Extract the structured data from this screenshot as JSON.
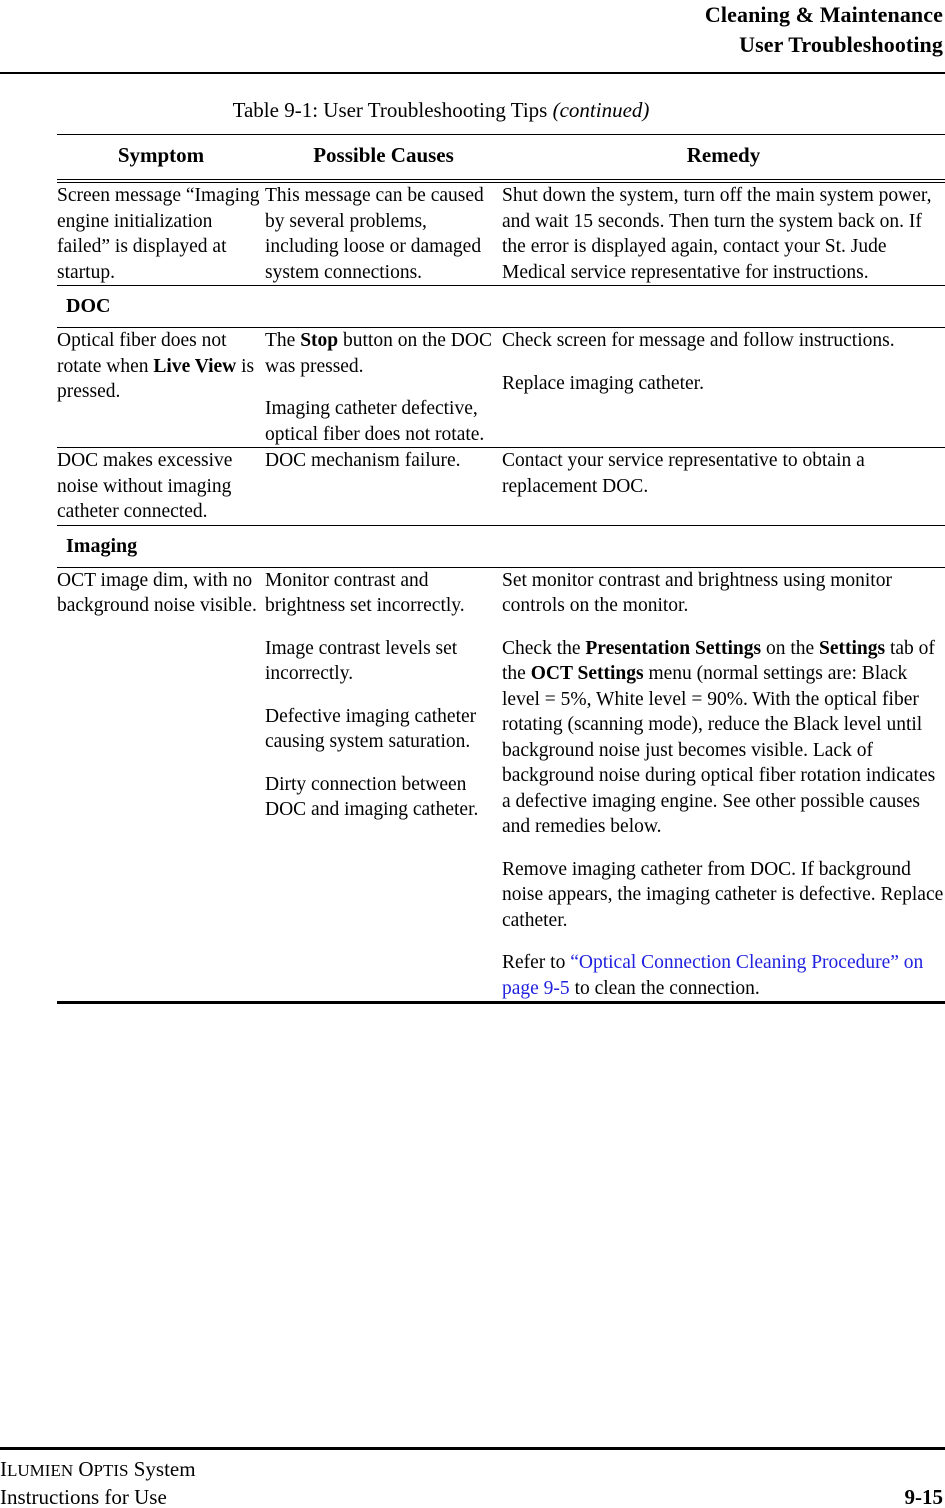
{
  "header": {
    "line1": "Cleaning & Maintenance",
    "line2": "User Troubleshooting"
  },
  "table": {
    "caption_main": "Table 9-1:  User Troubleshooting Tips ",
    "caption_continued": "(continued)",
    "columns": [
      "Symptom",
      "Possible Causes",
      "Remedy"
    ],
    "rows": [
      {
        "type": "data",
        "symptom": "Screen message “Imaging engine initialization failed” is displayed at startup.",
        "causes": [
          "This message can be caused by several problems, including loose or damaged system connections."
        ],
        "remedies": [
          "Shut down the system, turn off the main system power, and wait 15 seconds. Then turn the system back on. If the error is displayed again, contact your St. Jude Medical service representative for instructions."
        ]
      },
      {
        "type": "section",
        "label": "DOC"
      },
      {
        "type": "data",
        "symptom_parts": [
          {
            "text": "Optical fiber does not rotate when ",
            "bold": false
          },
          {
            "text": "Live View",
            "bold": true
          },
          {
            "text": " is pressed.",
            "bold": false
          }
        ],
        "causes_parts": [
          [
            {
              "text": "The ",
              "bold": false
            },
            {
              "text": "Stop",
              "bold": true
            },
            {
              "text": " button on the DOC was pressed.",
              "bold": false
            }
          ],
          [
            {
              "text": "Imaging catheter defective, optical fiber does not rotate.",
              "bold": false
            }
          ]
        ],
        "remedies_parts": [
          [
            {
              "text": "Check screen for message and follow instructions.",
              "bold": false
            }
          ],
          [
            {
              "text": "Replace imaging catheter.",
              "bold": false
            }
          ]
        ]
      },
      {
        "type": "data",
        "symptom": "DOC makes excessive noise without imaging catheter connected.",
        "causes": [
          "DOC mechanism failure."
        ],
        "remedies": [
          "Contact your service representative to obtain a replacement DOC."
        ]
      },
      {
        "type": "section",
        "label": "Imaging"
      },
      {
        "type": "data",
        "symptom": "OCT image dim, with no background noise visible.",
        "causes_parts": [
          [
            {
              "text": "Monitor contrast and brightness set incorrectly.",
              "bold": false
            }
          ],
          [
            {
              "text": "Image contrast levels set incorrectly.",
              "bold": false
            }
          ],
          [
            {
              "text": "Defective imaging catheter causing system saturation.",
              "bold": false
            }
          ],
          [
            {
              "text": "Dirty connection between DOC and imaging catheter.",
              "bold": false
            }
          ]
        ],
        "remedies_parts": [
          [
            {
              "text": "Set monitor contrast and brightness using monitor controls on the monitor.",
              "bold": false
            }
          ],
          [
            {
              "text": "Check the ",
              "bold": false
            },
            {
              "text": "Presentation Settings",
              "bold": true
            },
            {
              "text": " on the ",
              "bold": false
            },
            {
              "text": "Settings",
              "bold": true
            },
            {
              "text": " tab of the ",
              "bold": false
            },
            {
              "text": "OCT Settings",
              "bold": true
            },
            {
              "text": " menu (normal settings are:  Black level = 5%, White level = 90%. With the optical fiber rotating (scanning mode), reduce the Black level until background noise just becomes visible. Lack of background noise during optical fiber rotation indicates a defective imaging engine. See other possible causes and remedies below.",
              "bold": false
            }
          ],
          [
            {
              "text": "Remove imaging catheter from DOC. If background noise appears, the imaging catheter is defective. Replace catheter.",
              "bold": false
            }
          ],
          [
            {
              "text": "Refer to ",
              "bold": false
            },
            {
              "text": "“Optical Connection Cleaning Procedure” on page 9-5",
              "bold": false,
              "link": true
            },
            {
              "text": " to clean the connection.",
              "bold": false
            }
          ]
        ]
      }
    ]
  },
  "footer": {
    "product_line_small_1": "I",
    "product_line_caps_1": "LUMIEN",
    "product_line_small_2": " O",
    "product_line_caps_2": "PTIS",
    "product_line_rest": " System",
    "doc_title": "Instructions for Use",
    "page_number": "9-15"
  },
  "colors": {
    "link": "#2121e0",
    "text": "#000000",
    "background": "#ffffff"
  }
}
